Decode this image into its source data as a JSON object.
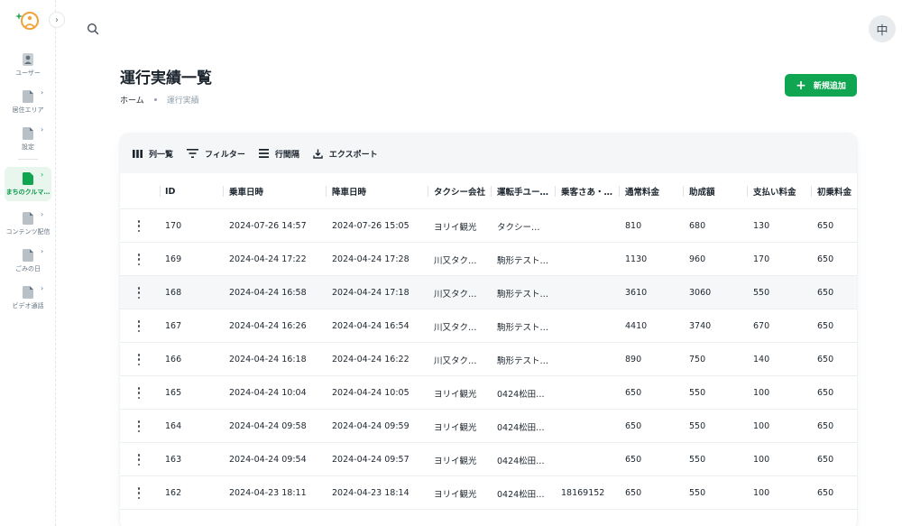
{
  "sidebar": {
    "items": [
      {
        "label": "ユーザー",
        "icon": "user-icon",
        "chevron": false,
        "active": false
      },
      {
        "label": "居住エリア",
        "icon": "document-icon",
        "chevron": true,
        "active": false
      },
      {
        "label": "設定",
        "icon": "document-icon",
        "chevron": true,
        "active": false
      },
      {
        "label": "まちのクルマ…",
        "icon": "document-icon",
        "chevron": true,
        "active": true
      },
      {
        "label": "コンテンツ配信",
        "icon": "document-icon",
        "chevron": true,
        "active": false
      },
      {
        "label": "ごみの日",
        "icon": "document-icon",
        "chevron": true,
        "active": false
      },
      {
        "label": "ビデオ通話",
        "icon": "document-icon",
        "chevron": true,
        "active": false
      }
    ],
    "chevron_glyph": "›"
  },
  "header": {
    "avatar_text": "中"
  },
  "page": {
    "title": "運行実績一覧",
    "breadcrumb": {
      "home": "ホーム",
      "current": "運行実績"
    },
    "add_button_label": "新規追加",
    "add_button_plus": "+"
  },
  "toolbar": {
    "columns_label": "列一覧",
    "filter_label": "フィルター",
    "density_label": "行間隔",
    "export_label": "エクスポート"
  },
  "table": {
    "headers": [
      "ID",
      "乗車日時",
      "降車日時",
      "タクシー会社",
      "運転手ユー…",
      "乗客さあ・…",
      "通常料金",
      "助成額",
      "支払い料金",
      "初乗料金"
    ],
    "rows": [
      [
        "170",
        "2024-07-26 14:57",
        "2024-07-26 15:05",
        "ヨリイ観光",
        "タクシー…",
        "",
        "810",
        "680",
        "130",
        "650"
      ],
      [
        "169",
        "2024-04-24 17:22",
        "2024-04-24 17:28",
        "川又タク…",
        "駒形テスト…",
        "",
        "1130",
        "960",
        "170",
        "650"
      ],
      [
        "168",
        "2024-04-24 16:58",
        "2024-04-24 17:18",
        "川又タク…",
        "駒形テスト…",
        "",
        "3610",
        "3060",
        "550",
        "650"
      ],
      [
        "167",
        "2024-04-24 16:26",
        "2024-04-24 16:54",
        "川又タク…",
        "駒形テスト…",
        "",
        "4410",
        "3740",
        "670",
        "650"
      ],
      [
        "166",
        "2024-04-24 16:18",
        "2024-04-24 16:22",
        "川又タク…",
        "駒形テスト…",
        "",
        "890",
        "750",
        "140",
        "650"
      ],
      [
        "165",
        "2024-04-24 10:04",
        "2024-04-24 10:05",
        "ヨリイ観光",
        "0424松田…",
        "",
        "650",
        "550",
        "100",
        "650"
      ],
      [
        "164",
        "2024-04-24 09:58",
        "2024-04-24 09:59",
        "ヨリイ観光",
        "0424松田…",
        "",
        "650",
        "550",
        "100",
        "650"
      ],
      [
        "163",
        "2024-04-24 09:54",
        "2024-04-24 09:57",
        "ヨリイ観光",
        "0424松田…",
        "",
        "650",
        "550",
        "100",
        "650"
      ],
      [
        "162",
        "2024-04-23 18:11",
        "2024-04-23 18:14",
        "ヨリイ観光",
        "0424松田…",
        "18169152",
        "650",
        "550",
        "100",
        "650"
      ]
    ]
  },
  "colors": {
    "accent": "#10a651",
    "active_bg": "#e8f6ee",
    "active_text": "#0b9a4a"
  }
}
